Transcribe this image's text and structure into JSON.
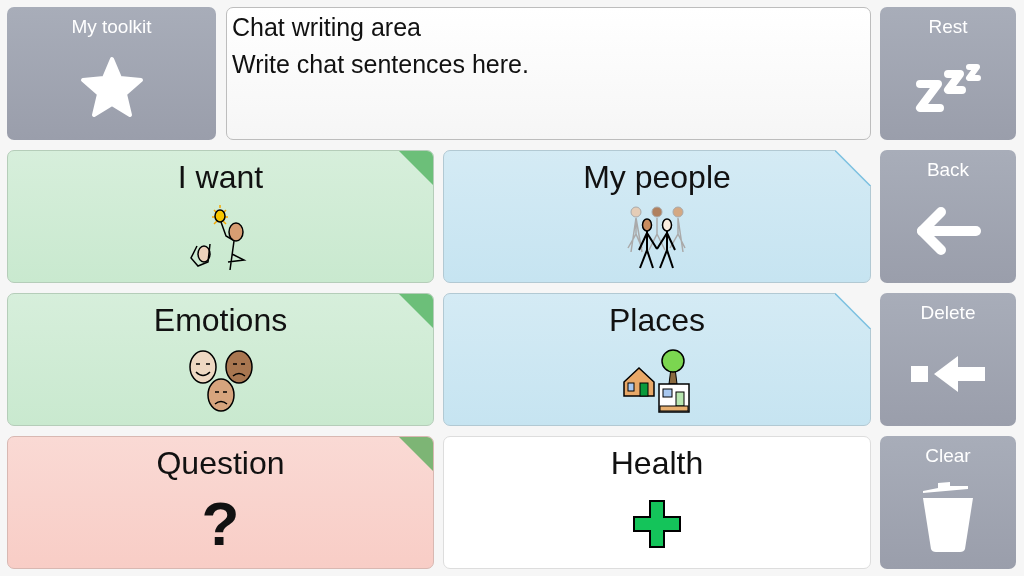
{
  "toolkit": {
    "label": "My toolkit"
  },
  "chat": {
    "title": "Chat writing area",
    "placeholder": "Write chat sentences here."
  },
  "tiles": [
    {
      "label": "I want",
      "kind": "want",
      "color": "#c9e9cf",
      "corner_flag": true,
      "corner_cut": false
    },
    {
      "label": "My people",
      "kind": "people",
      "color": "#c6e4f1",
      "corner_flag": false,
      "corner_cut": true
    },
    {
      "label": "Emotions",
      "kind": "emotions",
      "color": "#c9e9cf",
      "corner_flag": true,
      "corner_cut": false
    },
    {
      "label": "Places",
      "kind": "places",
      "color": "#c6e4f1",
      "corner_flag": false,
      "corner_cut": true
    },
    {
      "label": "Question",
      "kind": "question",
      "color": "#f8cdc6",
      "corner_flag": true,
      "corner_cut": false,
      "symbol": "?"
    },
    {
      "label": "Health",
      "kind": "health",
      "color": "#ffffff",
      "corner_flag": false,
      "corner_cut": false
    }
  ],
  "side_buttons": [
    {
      "label": "Rest",
      "kind": "rest"
    },
    {
      "label": "Back",
      "kind": "back"
    },
    {
      "label": "Delete",
      "kind": "delete"
    },
    {
      "label": "Clear",
      "kind": "clear"
    }
  ]
}
